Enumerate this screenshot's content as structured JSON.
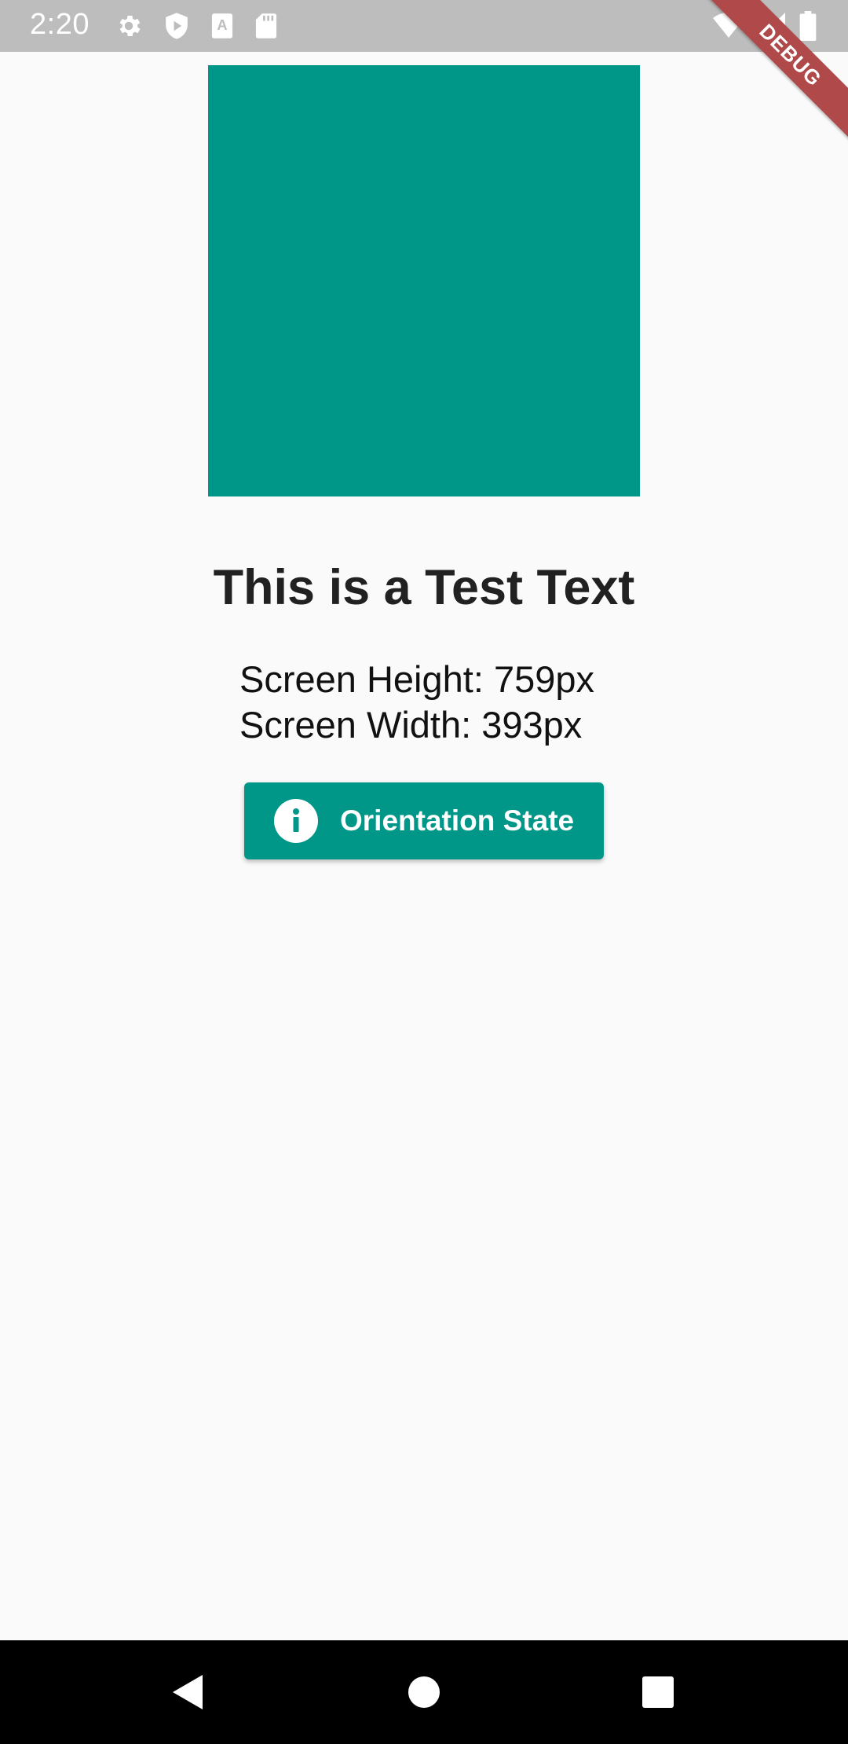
{
  "status_bar": {
    "time": "2:20",
    "icons_left": [
      "gear-icon",
      "play-shield-icon",
      "a-letter-icon",
      "sd-card-icon"
    ],
    "icons_right": [
      "wifi-icon",
      "cell-signal-icon",
      "battery-icon"
    ]
  },
  "debug_banner": {
    "label": "DEBUG"
  },
  "main": {
    "square_color": "#009688",
    "title": "This is a Test Text",
    "screen_height": "Screen Height: 759px",
    "screen_width": "Screen Width: 393px",
    "button": {
      "label": "Orientation State",
      "icon": "info-icon",
      "color": "#009688"
    }
  },
  "nav_bar": {
    "buttons": [
      "back-icon",
      "home-icon",
      "recents-icon"
    ]
  }
}
